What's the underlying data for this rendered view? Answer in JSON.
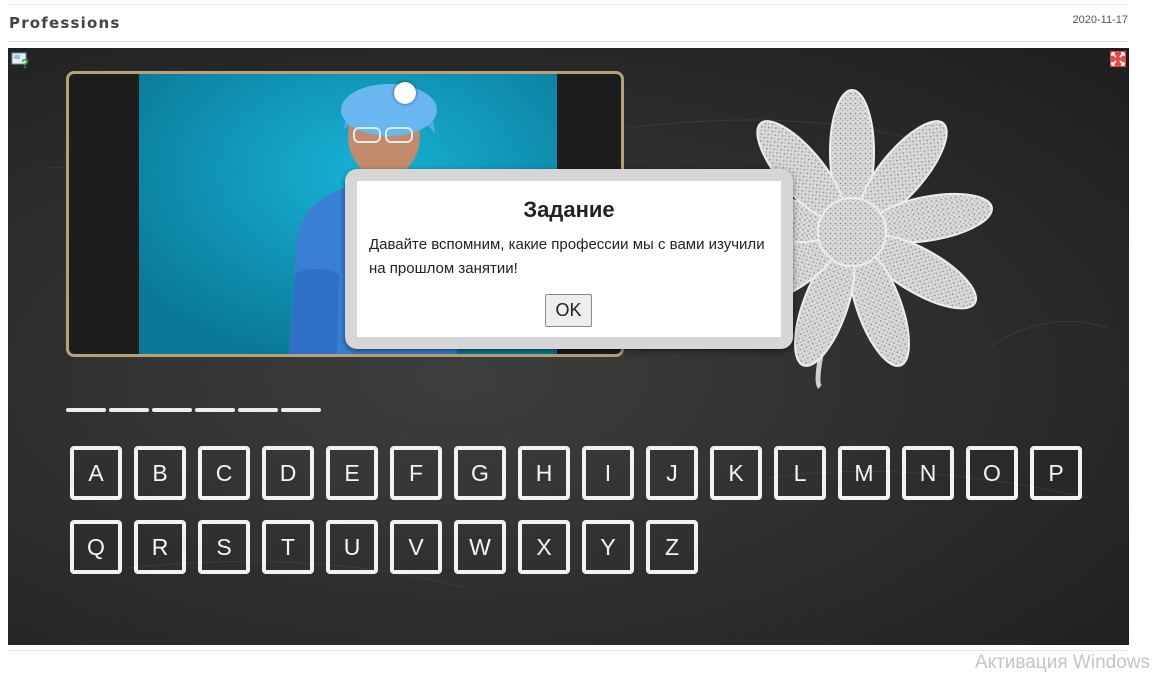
{
  "header": {
    "title": "Professions",
    "date": "2020-11-17"
  },
  "dialog": {
    "title": "Задание",
    "message": "Давайте вспомним, какие профессии мы с вами изучили на прошлом занятии!",
    "ok_label": "OK"
  },
  "keyboard": {
    "row1": [
      "A",
      "B",
      "C",
      "D",
      "E",
      "F",
      "G",
      "H",
      "I",
      "J",
      "K",
      "L",
      "M",
      "N",
      "O",
      "P"
    ],
    "row2": [
      "Q",
      "R",
      "S",
      "T",
      "U",
      "V",
      "W",
      "X",
      "Y",
      "Z"
    ]
  },
  "answer_blank_count": 6,
  "system": {
    "watermark": "Активация Windows"
  },
  "icons": {
    "help": "help-icon",
    "fullscreen": "fullscreen-icon",
    "slider": "slider-knob"
  },
  "colors": {
    "board": "#2c2c2c",
    "chalk": "#f2f2f2",
    "frame": "#b5a27a",
    "photo_bg": "#1a8fb0"
  }
}
